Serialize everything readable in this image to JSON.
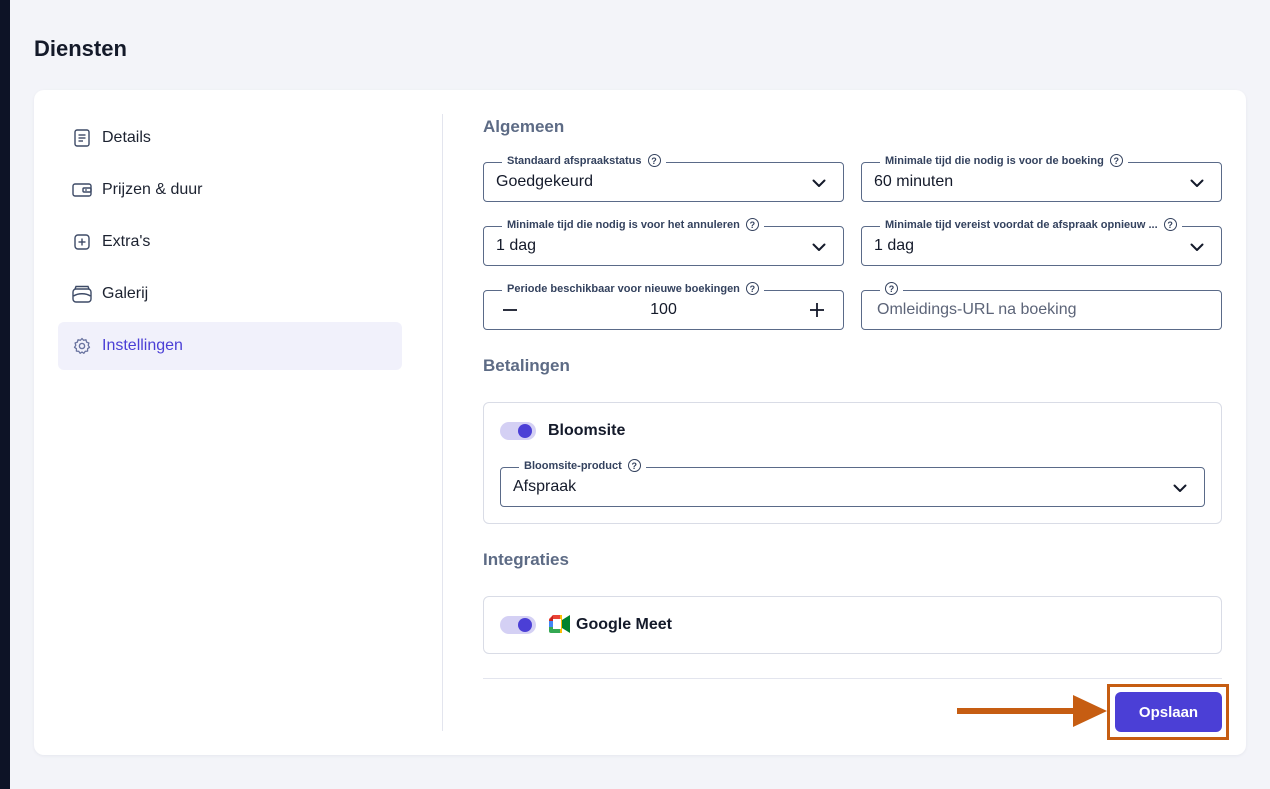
{
  "page": {
    "title": "Diensten"
  },
  "sidebar": {
    "items": [
      {
        "label": "Details",
        "icon": "document-icon"
      },
      {
        "label": "Prijzen & duur",
        "icon": "wallet-icon"
      },
      {
        "label": "Extra's",
        "icon": "plus-square-icon"
      },
      {
        "label": "Galerij",
        "icon": "gallery-icon"
      },
      {
        "label": "Instellingen",
        "icon": "gear-icon",
        "active": true
      }
    ]
  },
  "general": {
    "title": "Algemeen",
    "status": {
      "label": "Standaard afspraakstatus",
      "value": "Goedgekeurd"
    },
    "min_booking": {
      "label": "Minimale tijd die nodig is voor de boeking",
      "value": "60 minuten"
    },
    "min_cancel": {
      "label": "Minimale tijd die nodig is voor het annuleren",
      "value": "1 dag"
    },
    "min_reschedule": {
      "label": "Minimale tijd vereist voordat de afspraak opnieuw ...",
      "value": "1 dag"
    },
    "period": {
      "label": "Periode beschikbaar voor nieuwe boekingen",
      "value": "100"
    },
    "redirect": {
      "label": "",
      "placeholder": "Omleidings-URL na boeking"
    }
  },
  "payments": {
    "title": "Betalingen",
    "provider": {
      "name": "Bloomsite",
      "enabled": true
    },
    "product": {
      "label": "Bloomsite-product",
      "value": "Afspraak"
    }
  },
  "integrations": {
    "title": "Integraties",
    "google_meet": {
      "name": "Google Meet",
      "enabled": true
    }
  },
  "actions": {
    "save_label": "Opslaan"
  },
  "colors": {
    "accent": "#4b3fd6",
    "annotation": "#c65d12"
  }
}
